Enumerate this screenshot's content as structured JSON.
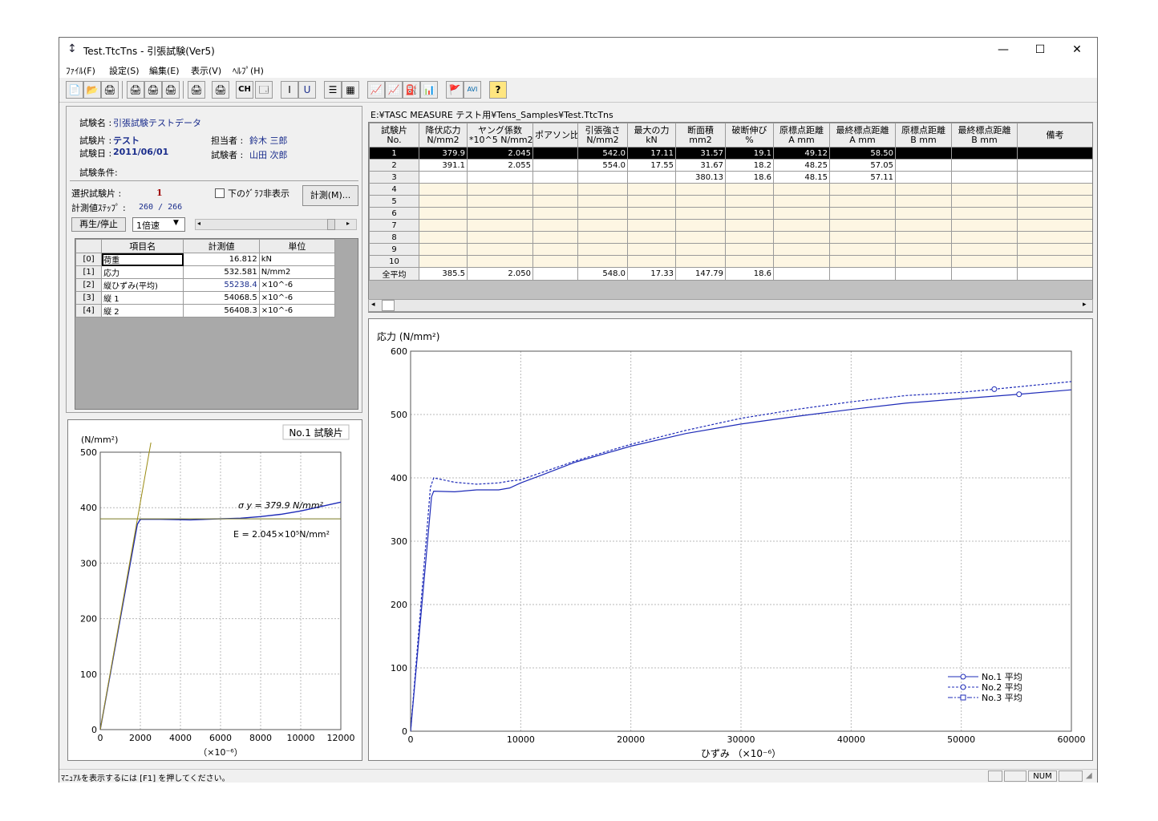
{
  "window": {
    "title": "Test.TtcTns - 引張試験(Ver5)",
    "minimize": "—",
    "maximize": "☐",
    "close": "✕",
    "app_icon": "tensile-icon"
  },
  "menu": [
    "ﾌｧｲﾙ(F)",
    "設定(S)",
    "編集(E)",
    "表示(V)",
    "ﾍﾙﾌﾟ(H)"
  ],
  "toolbar": [
    "📄",
    "📂",
    "🖨",
    "🖨",
    "🖨",
    "🖨",
    "🖨",
    "🖨",
    "CH",
    "🗔",
    "I",
    "U",
    "☰",
    "▦",
    "📈",
    "📈",
    "⛽",
    "📊",
    "🚩",
    "AVI",
    "?"
  ],
  "info": {
    "test_name_label": "試験名 :",
    "test_name": "引張試験テストデータ",
    "specimen_label": "試験片 :",
    "specimen": "テスト",
    "date_label": "試験日 :",
    "date": "2011/06/01",
    "person_label": "担当者 :",
    "person": "鈴木 三郎",
    "tester_label": "試験者 :",
    "tester": "山田 次郎",
    "conditions_label": "試験条件:"
  },
  "controls": {
    "selected_label": "選択試験片 :",
    "selected_value": "1",
    "hide_graph_label": "下のｸﾞﾗﾌ非表示",
    "measure_button": "計測(M)...",
    "step_label": "計測値ｽﾃｯﾌﾟ :",
    "step_value": "260 / 266",
    "play_button": "再生/停止",
    "speed_value": "1倍速"
  },
  "measure_table": {
    "headers": [
      "項目名",
      "計測値",
      "単位"
    ],
    "rows": [
      {
        "idx": "[0]",
        "name": "荷重",
        "value": "16.812",
        "unit": "kN"
      },
      {
        "idx": "[1]",
        "name": "応力",
        "value": "532.581",
        "unit": "N/mm2"
      },
      {
        "idx": "[2]",
        "name": "縦ひずみ(平均)",
        "value": "55238.4",
        "unit": "×10^-6"
      },
      {
        "idx": "[3]",
        "name": "縦 1",
        "value": "54068.5",
        "unit": "×10^-6"
      },
      {
        "idx": "[4]",
        "name": "縦 2",
        "value": "56408.3",
        "unit": "×10^-6"
      }
    ]
  },
  "file_path": "E:¥TASC MEASURE テスト用¥Tens_Samples¥Test.TtcTns",
  "results_table": {
    "headers": [
      [
        "試験片",
        "No."
      ],
      [
        "降伏応力",
        "N/mm2"
      ],
      [
        "ヤング係数",
        "*10^5 N/mm2"
      ],
      [
        "ポアソン比",
        ""
      ],
      [
        "引張強さ",
        "N/mm2"
      ],
      [
        "最大の力",
        "kN"
      ],
      [
        "断面積",
        "mm2"
      ],
      [
        "破断伸び",
        "%"
      ],
      [
        "原標点距離",
        "A mm"
      ],
      [
        "最終標点距離",
        "A mm"
      ],
      [
        "原標点距離",
        "B mm"
      ],
      [
        "最終標点距離",
        "B mm"
      ],
      [
        "備考",
        ""
      ]
    ],
    "rows": [
      [
        "1",
        "379.9",
        "2.045",
        "",
        "542.0",
        "17.11",
        "31.57",
        "19.1",
        "49.12",
        "58.50",
        "",
        "",
        ""
      ],
      [
        "2",
        "391.1",
        "2.055",
        "",
        "554.0",
        "17.55",
        "31.67",
        "18.2",
        "48.25",
        "57.05",
        "",
        "",
        ""
      ],
      [
        "3",
        "",
        "",
        "",
        "",
        "",
        "380.13",
        "18.6",
        "48.15",
        "57.11",
        "",
        "",
        ""
      ],
      [
        "4",
        "",
        "",
        "",
        "",
        "",
        "",
        "",
        "",
        "",
        "",
        "",
        ""
      ],
      [
        "5",
        "",
        "",
        "",
        "",
        "",
        "",
        "",
        "",
        "",
        "",
        "",
        ""
      ],
      [
        "6",
        "",
        "",
        "",
        "",
        "",
        "",
        "",
        "",
        "",
        "",
        "",
        ""
      ],
      [
        "7",
        "",
        "",
        "",
        "",
        "",
        "",
        "",
        "",
        "",
        "",
        "",
        ""
      ],
      [
        "8",
        "",
        "",
        "",
        "",
        "",
        "",
        "",
        "",
        "",
        "",
        "",
        ""
      ],
      [
        "9",
        "",
        "",
        "",
        "",
        "",
        "",
        "",
        "",
        "",
        "",
        "",
        ""
      ],
      [
        "10",
        "",
        "",
        "",
        "",
        "",
        "",
        "",
        "",
        "",
        "",
        "",
        ""
      ]
    ],
    "average": [
      "全平均",
      "385.5",
      "2.050",
      "",
      "548.0",
      "17.33",
      "147.79",
      "18.6",
      "",
      "",
      "",
      "",
      ""
    ]
  },
  "chart_data": [
    {
      "type": "line",
      "title": "No.1 試験片",
      "ylabel": "(N/mm²)",
      "xlabel": "（×10⁻⁶）",
      "xlim": [
        0,
        12000
      ],
      "ylim": [
        0,
        500
      ],
      "xticks": [
        "0",
        "2000",
        "4000",
        "6000",
        "8000",
        "10000",
        "12000"
      ],
      "yticks": [
        "0",
        "100",
        "200",
        "300",
        "400",
        "500"
      ],
      "grid": true,
      "annotations": [
        "σ y = 379.9  N/mm²",
        "E = 2.045×10⁵N/mm²"
      ],
      "series": [
        {
          "x": [
            0,
            1850,
            2000,
            3000,
            4500,
            6000,
            7000,
            8000,
            9000,
            10000,
            11000,
            12000
          ],
          "y": [
            0,
            370,
            379,
            379,
            378,
            380,
            381,
            384,
            388,
            394,
            402,
            410
          ]
        },
        {
          "x": [
            0,
            12000
          ],
          "y": [
            379.9,
            379.9
          ]
        },
        {
          "x": [
            0,
            2550
          ],
          "y": [
            0,
            522
          ]
        }
      ]
    },
    {
      "type": "line",
      "ylabel": "応力 (N/mm²)",
      "xlabel": "ひずみ （×10⁻⁶）",
      "xlim": [
        0,
        60000
      ],
      "ylim": [
        0,
        600
      ],
      "xticks": [
        "0",
        "10000",
        "20000",
        "30000",
        "40000",
        "50000",
        "60000"
      ],
      "yticks": [
        "0",
        "100",
        "200",
        "300",
        "400",
        "500",
        "600"
      ],
      "grid": true,
      "legend_position": "bottom-right",
      "series": [
        {
          "name": "No.1 平均",
          "x": [
            0,
            1900,
            2100,
            4000,
            6000,
            8000,
            9000,
            10000,
            12000,
            15000,
            20000,
            25000,
            30000,
            35000,
            40000,
            45000,
            50000,
            55250,
            60000
          ],
          "y": [
            0,
            370,
            379,
            378,
            381,
            381,
            384,
            392,
            405,
            425,
            450,
            470,
            485,
            497,
            508,
            518,
            525,
            532,
            539
          ]
        },
        {
          "name": "No.2 平均",
          "x": [
            0,
            1800,
            2100,
            4000,
            6000,
            8000,
            9000,
            10000,
            12000,
            15000,
            20000,
            25000,
            30000,
            35000,
            40000,
            45000,
            50000,
            53000,
            60000
          ],
          "y": [
            0,
            385,
            400,
            393,
            390,
            392,
            395,
            397,
            409,
            427,
            453,
            475,
            494,
            508,
            520,
            530,
            535,
            540,
            552
          ]
        },
        {
          "name": "No.3 平均",
          "x": [],
          "y": []
        }
      ]
    }
  ],
  "status": {
    "text": "ﾏﾆｭｱﾙを表示するには [F1] を押してください。",
    "num": "NUM"
  }
}
